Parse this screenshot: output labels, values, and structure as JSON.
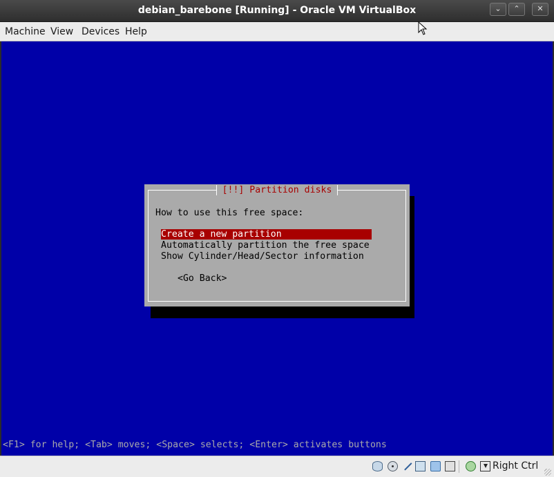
{
  "window": {
    "title": "debian_barebone [Running] - Oracle VM VirtualBox",
    "buttons": {
      "minimize_icon": "minimize-icon",
      "maximize_icon": "maximize-icon",
      "close_icon": "close-icon"
    }
  },
  "menubar": {
    "items": [
      {
        "label": "Machine"
      },
      {
        "label": "View"
      },
      {
        "label": "Devices"
      },
      {
        "label": "Help"
      }
    ]
  },
  "installer": {
    "background_color": "#0000a8",
    "dialog": {
      "title": "[!!] Partition disks",
      "question": "How to use this free space:",
      "options": [
        {
          "label": "Create a new partition",
          "selected": true
        },
        {
          "label": "Automatically partition the free space",
          "selected": false
        },
        {
          "label": "Show Cylinder/Head/Sector information",
          "selected": false
        }
      ],
      "go_back": "<Go Back>",
      "title_color": "#a80000",
      "highlight_color": "#a80000"
    },
    "help_line": "<F1> for help; <Tab> moves; <Space> selects; <Enter> activates buttons"
  },
  "statusbar": {
    "icons": [
      "hard-disk-icon",
      "optical-drive-icon",
      "usb-icon",
      "network-icon",
      "shared-folder-icon",
      "video-capture-icon",
      "virtualization-icon",
      "keyboard-capture-icon"
    ],
    "host_key": "Right Ctrl"
  }
}
